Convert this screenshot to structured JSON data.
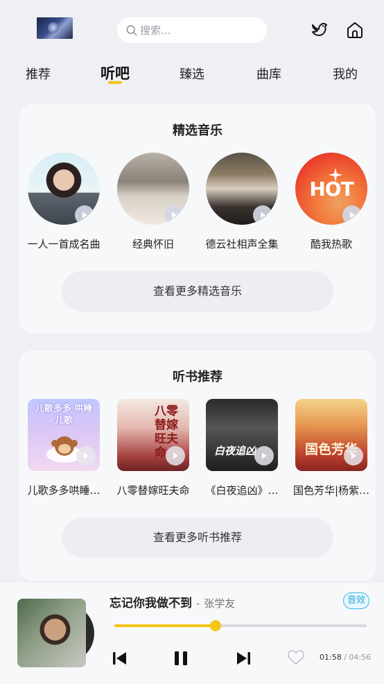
{
  "header": {
    "search_placeholder": "搜索..."
  },
  "tabs": [
    {
      "label": "推荐"
    },
    {
      "label": "听吧",
      "active": true
    },
    {
      "label": "臻选"
    },
    {
      "label": "曲库"
    },
    {
      "label": "我的"
    }
  ],
  "featured_music": {
    "title": "精选音乐",
    "items": [
      {
        "name": "一人一首成名曲"
      },
      {
        "name": "经典怀旧"
      },
      {
        "name": "德云社相声全集"
      },
      {
        "name": "酷我热歌",
        "cover_text": "HOT"
      }
    ],
    "more_label": "查看更多精选音乐"
  },
  "audiobooks": {
    "title": "听书推荐",
    "items": [
      {
        "name": "儿歌多多哄睡…",
        "cover_text": "儿歌多多 哄睡儿歌"
      },
      {
        "name": "八零替嫁旺夫命",
        "cover_text": "八零替嫁旺夫命"
      },
      {
        "name": "《白夜追凶》…",
        "cover_text": "白夜追凶"
      },
      {
        "name": "国色芳华|杨紫…",
        "cover_text": "国色芳华"
      }
    ],
    "more_label": "查看更多听书推荐"
  },
  "player": {
    "song_title": "忘记你我做不到",
    "separator": "-",
    "artist": "张学友",
    "effect_label": "音效",
    "elapsed": "01:58",
    "time_separator": "/",
    "total": "04:56",
    "progress": 0.4
  },
  "colors": {
    "accent": "#f5c518",
    "effect_blue": "#39b8e6",
    "background": "#eef0f4"
  }
}
